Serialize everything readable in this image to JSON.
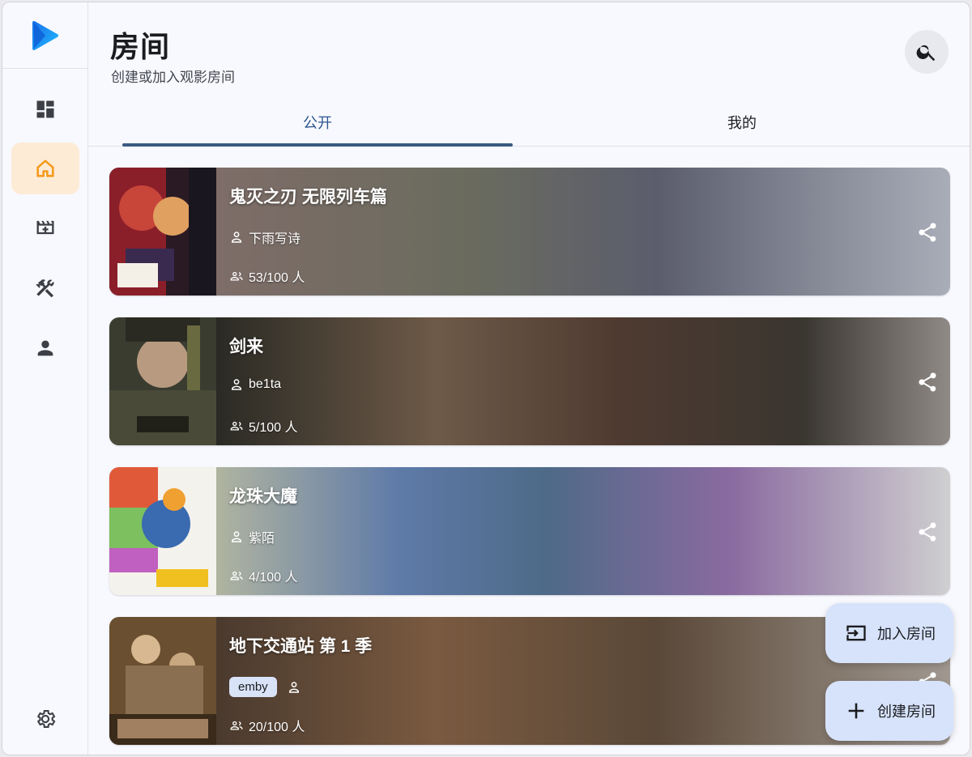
{
  "header": {
    "title": "房间",
    "subtitle": "创建或加入观影房间"
  },
  "tabs": [
    {
      "label": "公开",
      "active": true
    },
    {
      "label": "我的",
      "active": false
    }
  ],
  "nav": {
    "items": [
      {
        "icon": "dashboard-icon"
      },
      {
        "icon": "home-icon",
        "active": true
      },
      {
        "icon": "movie-add-icon"
      },
      {
        "icon": "tools-icon"
      },
      {
        "icon": "person-icon"
      }
    ],
    "bottom_icon": "settings-icon"
  },
  "rooms": [
    {
      "name": "鬼灭之刃 无限列车篇",
      "owner": "下雨写诗",
      "count": "53/100 人",
      "tag": ""
    },
    {
      "name": "剑来",
      "owner": "be1ta",
      "count": "5/100 人",
      "tag": ""
    },
    {
      "name": "龙珠大魔",
      "owner": "紫陌",
      "count": "4/100 人",
      "tag": ""
    },
    {
      "name": "地下交通站 第 1 季",
      "owner": "",
      "count": "20/100 人",
      "tag": "emby"
    }
  ],
  "fabs": {
    "join_label": "加入房间",
    "create_label": "创建房间"
  },
  "colors": {
    "accent": "#3b5a80",
    "active_nav_bg": "#fdebd6",
    "active_nav_icon": "#f59a1b",
    "fab_bg": "#d7e3fb"
  }
}
